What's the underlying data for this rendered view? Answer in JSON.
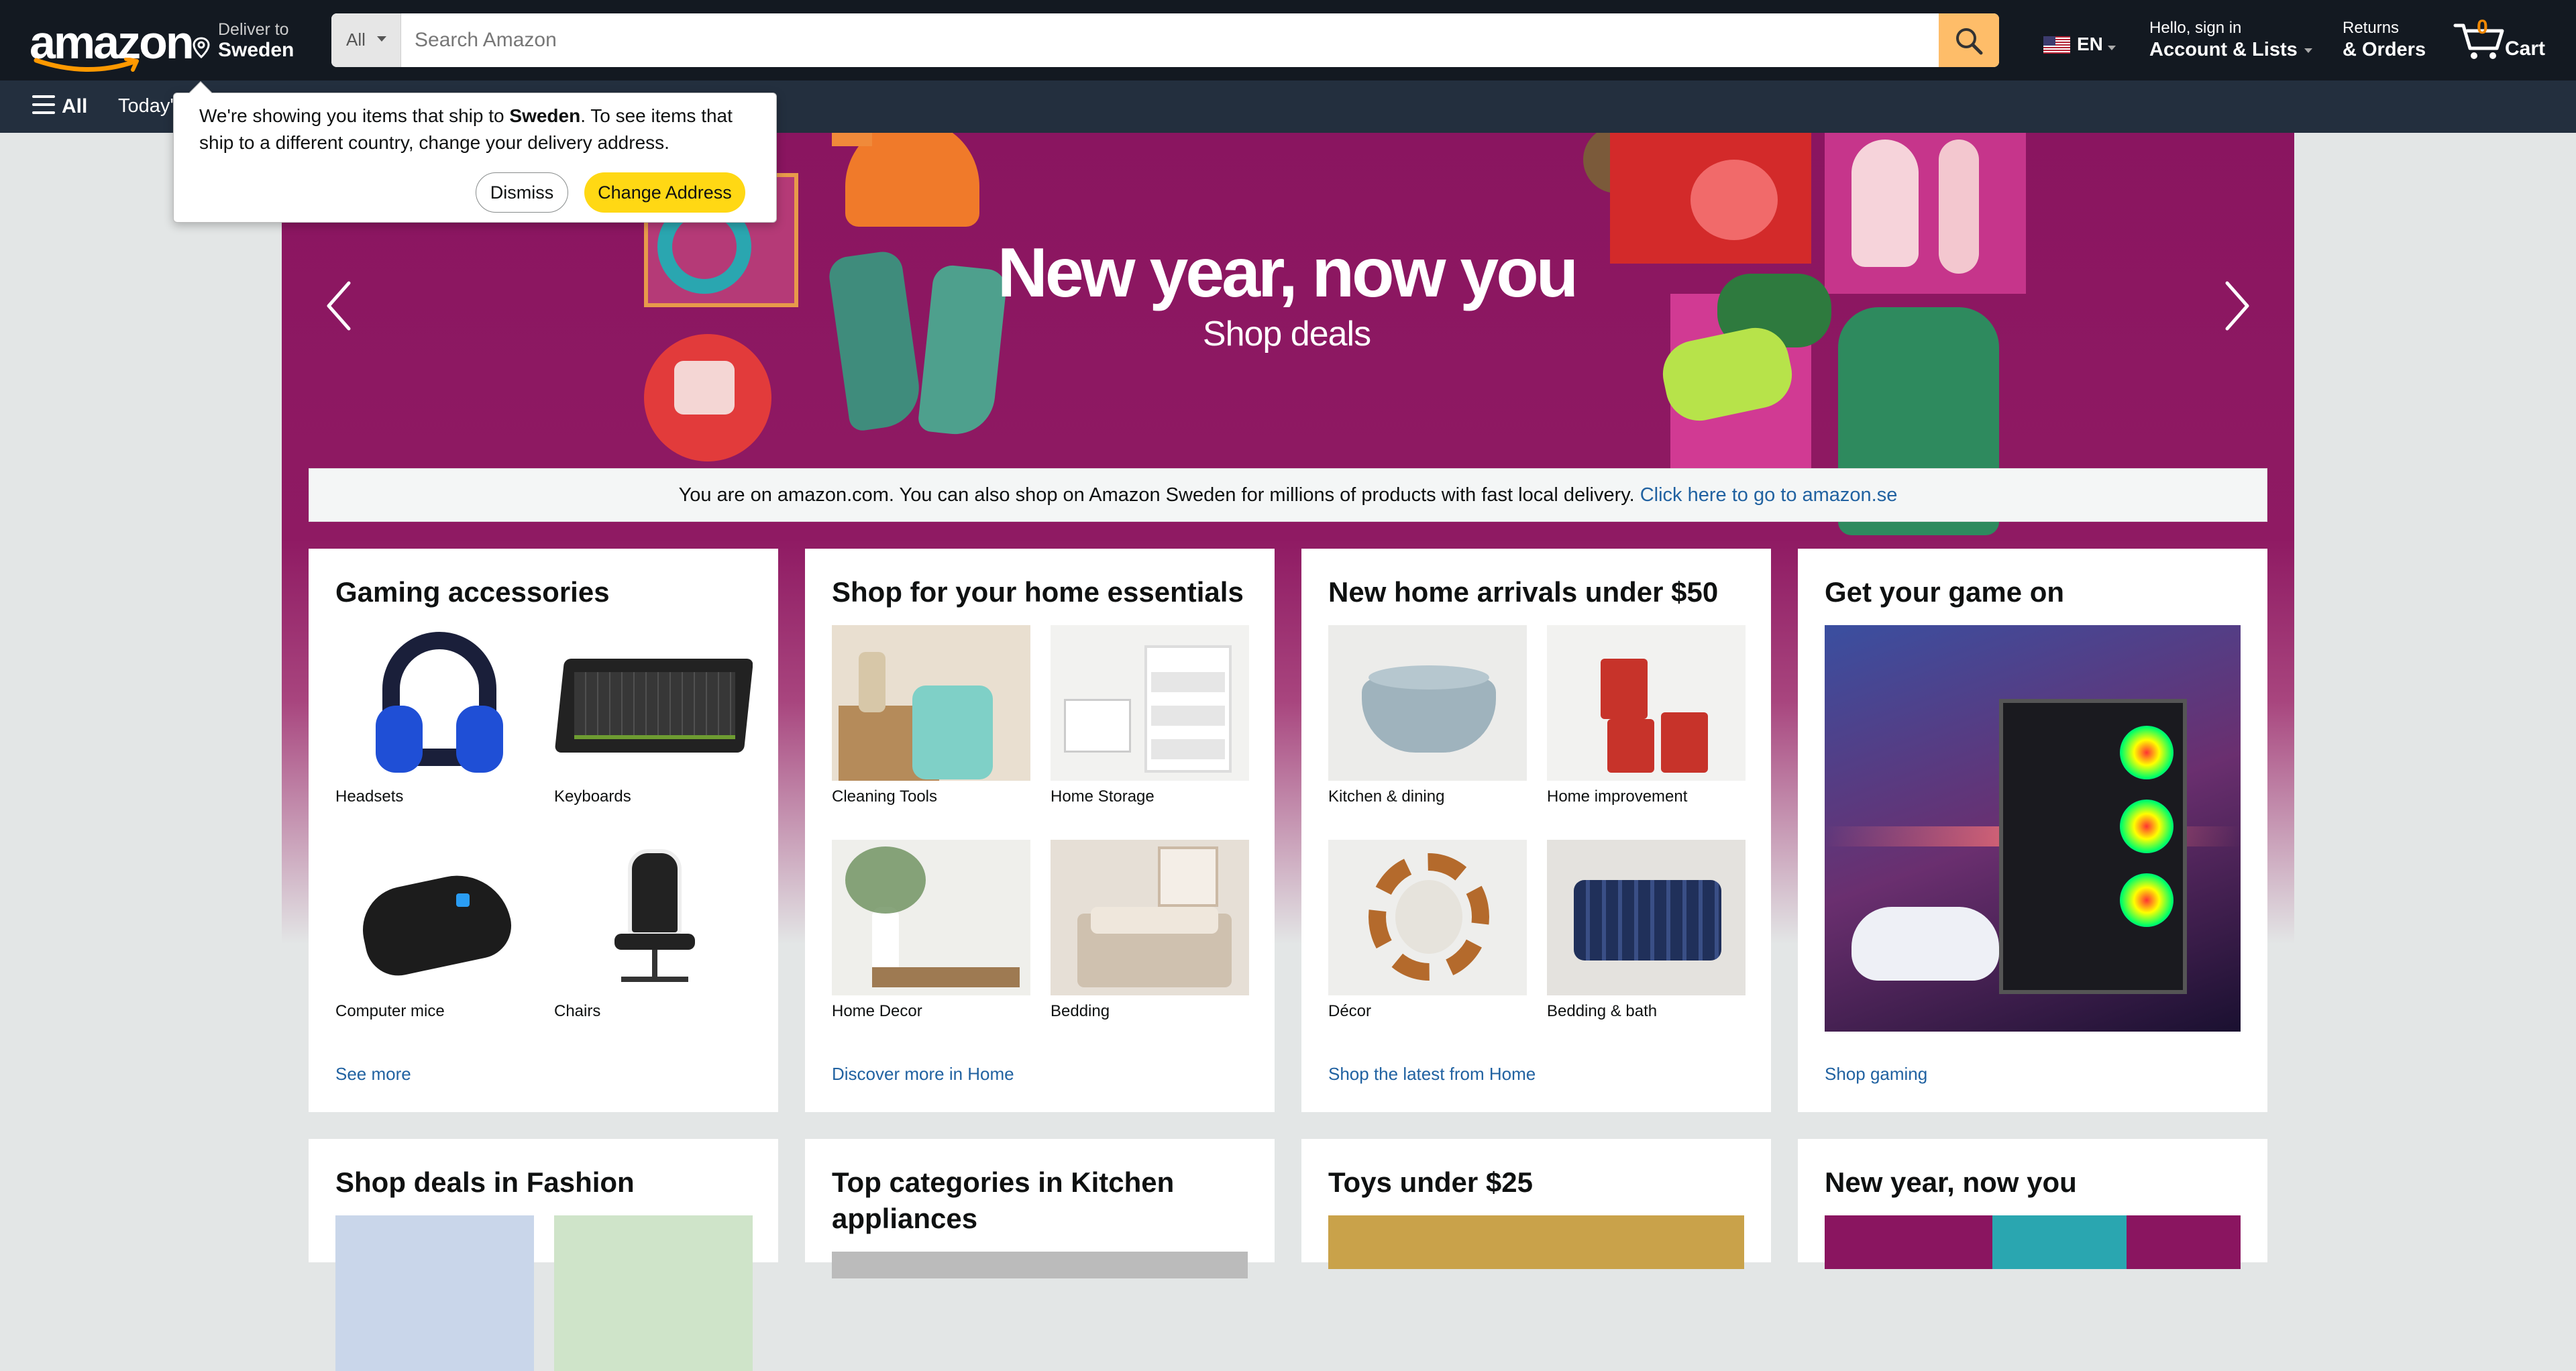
{
  "nav": {
    "logo": "amazon",
    "deliver_line1": "Deliver to",
    "deliver_line2": "Sweden",
    "search_category": "All",
    "search_placeholder": "Search Amazon",
    "lang": "EN",
    "account_line1": "Hello, sign in",
    "account_line2": "Account & Lists",
    "returns_line1": "Returns",
    "returns_line2": "& Orders",
    "cart_count": "0",
    "cart_label": "Cart"
  },
  "subnav": {
    "all_label": "All",
    "today": "Today's"
  },
  "popover": {
    "msg_pre": "We're showing you items that ship to ",
    "msg_country": "Sweden",
    "msg_post": ". To see items that ship to a different country, change your delivery address.",
    "dismiss": "Dismiss",
    "change": "Change Address"
  },
  "hero": {
    "title": "New year, now you",
    "subtitle": "Shop deals"
  },
  "notice": {
    "text": "You are on amazon.com. You can also shop on Amazon Sweden for millions of products with fast local delivery. ",
    "link": "Click here to go to amazon.se"
  },
  "cards": [
    {
      "title": "Gaming accessories",
      "tiles": [
        "Headsets",
        "Keyboards",
        "Computer mice",
        "Chairs"
      ],
      "more": "See more"
    },
    {
      "title": "Shop for your home essentials",
      "tiles": [
        "Cleaning Tools",
        "Home Storage",
        "Home Decor",
        "Bedding"
      ],
      "more": "Discover more in Home"
    },
    {
      "title": "New home arrivals under $50",
      "tiles": [
        "Kitchen & dining",
        "Home improvement",
        "Décor",
        "Bedding & bath"
      ],
      "more": "Shop the latest from Home"
    },
    {
      "title": "Get your game on",
      "more": "Shop gaming"
    }
  ],
  "row2": [
    {
      "title": "Shop deals in Fashion"
    },
    {
      "title": "Top categories in Kitchen appliances"
    },
    {
      "title": "Toys under $25"
    },
    {
      "title": "New year, now you"
    }
  ],
  "colors": {
    "nav_bg": "#131921",
    "subnav_bg": "#232f3e",
    "search_button": "#febd69",
    "primary_button": "#ffd814",
    "hero_bg": "#8a1560",
    "link": "#2162a1",
    "cart_count": "#f08804"
  }
}
